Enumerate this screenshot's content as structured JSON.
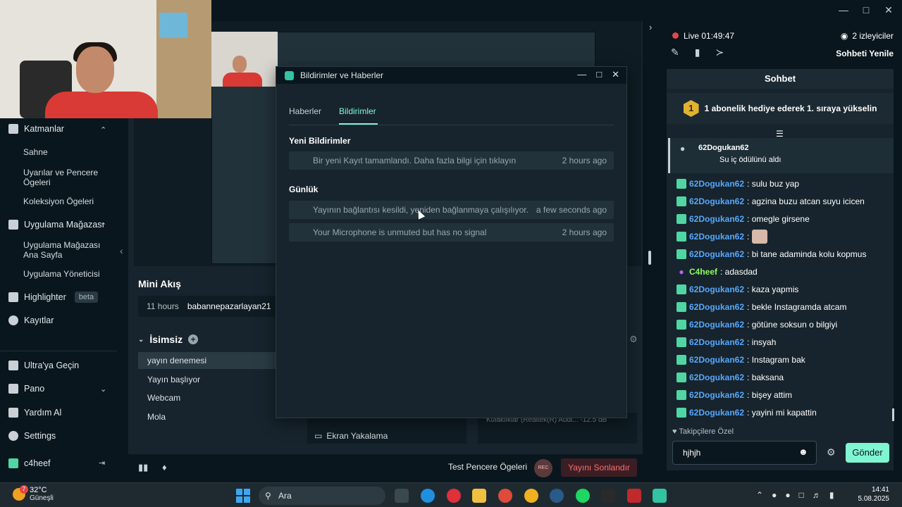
{
  "left_nav": {
    "items": [
      {
        "label": "Katmanlar"
      },
      {
        "label": "Sahne"
      },
      {
        "label": "Uyarılar ve Pencere Ögeleri"
      },
      {
        "label": "Koleksiyon Ögeleri"
      },
      {
        "label": "Uygulama Mağazası"
      },
      {
        "label": "Uygulama Mağazası Ana Sayfa"
      },
      {
        "label": "Uygulama Yöneticisi"
      },
      {
        "label": "Highlighter"
      },
      {
        "label": "Kayıtlar"
      },
      {
        "label": "Ultra'ya Geçin"
      },
      {
        "label": "Pano"
      },
      {
        "label": "Yardım Al"
      },
      {
        "label": "Settings"
      },
      {
        "label": "c4heef"
      }
    ],
    "beta_badge": "beta"
  },
  "mini_akis": {
    "title": "Mini Akış",
    "row": {
      "time": "11 hours",
      "name": "babannepazarlayan21"
    }
  },
  "scenes": {
    "title": "İsimsiz",
    "items": [
      "yayın denemesi",
      "Yayın başlıyor",
      "Webcam",
      "Mola"
    ]
  },
  "sources": {
    "item": "Ekran Yakalama"
  },
  "mixer": {
    "text": "Kulaklıklar (Realtek(R) Audi...   -12.5 dB"
  },
  "footer": {
    "test_label": "Test Pencere Ögeleri",
    "rec_label": "REC",
    "end_label": "Yayını Sonlandır"
  },
  "chat_header": {
    "live": "Live",
    "time": "01:49:47",
    "viewers": "2 izleyiciler",
    "refresh": "Sohbeti Yenile"
  },
  "chat": {
    "title": "Sohbet",
    "gift_badge": "1",
    "gift_text": "1 abonelik hediye ederek 1. sıraya yükselin",
    "redeem_user": "62Dogukan62",
    "redeem_text": "Su iç ödülünü aldı",
    "messages": [
      {
        "user": "62Dogukan62",
        "text": ": sulu buz yap"
      },
      {
        "user": "62Dogukan62",
        "text": ": agzina buzu atcan suyu icicen"
      },
      {
        "user": "62Dogukan62",
        "text": ": omegle girsene"
      },
      {
        "user": "62Dogukan62",
        "text": ":"
      },
      {
        "user": "62Dogukan62",
        "text": ": bi tane adaminda kolu kopmus"
      },
      {
        "user": "C4heef",
        "text": ": adasdad"
      },
      {
        "user": "62Dogukan62",
        "text": ": kaza yapmis"
      },
      {
        "user": "62Dogukan62",
        "text": ": bekle Instagramda atcam"
      },
      {
        "user": "62Dogukan62",
        "text": ": götüne soksun o bilgiyi"
      },
      {
        "user": "62Dogukan62",
        "text": ": insyah"
      },
      {
        "user": "62Dogukan62",
        "text": ": Instagram bak"
      },
      {
        "user": "62Dogukan62",
        "text": ": baksana"
      },
      {
        "user": "62Dogukan62",
        "text": ": bişey attim"
      },
      {
        "user": "62Dogukan62",
        "text": ": yayini mi kapattin"
      }
    ],
    "followers_only": "Takipçilere Özel",
    "input_value": "hjhjh",
    "send_label": "Gönder"
  },
  "dialog": {
    "title": "Bildirimler ve Haberler",
    "tabs": [
      "Haberler",
      "Bildirimler"
    ],
    "new_section": "Yeni Bildirimler",
    "new_items": [
      {
        "msg": "Bir yeni Kayıt tamamlandı. Daha fazla bilgi için tıklayın",
        "ago": "2 hours ago"
      }
    ],
    "log_section": "Günlük",
    "log_items": [
      {
        "msg": "Yayının bağlantısı kesildi, yeniden bağlanmaya çalışılıyor.",
        "ago": "a few seconds ago"
      },
      {
        "msg": "Your Microphone is unmuted but has no signal",
        "ago": "2 hours ago"
      }
    ]
  },
  "taskbar": {
    "weather_badge": "7",
    "temp": "32°C",
    "weather_desc": "Güneşli",
    "search_label": "Ara",
    "time": "14:41",
    "date": "5.08.2025"
  },
  "colors": {
    "accent": "#80f5d2",
    "live_red": "#e04848",
    "chat_user": "#55a8ff"
  }
}
